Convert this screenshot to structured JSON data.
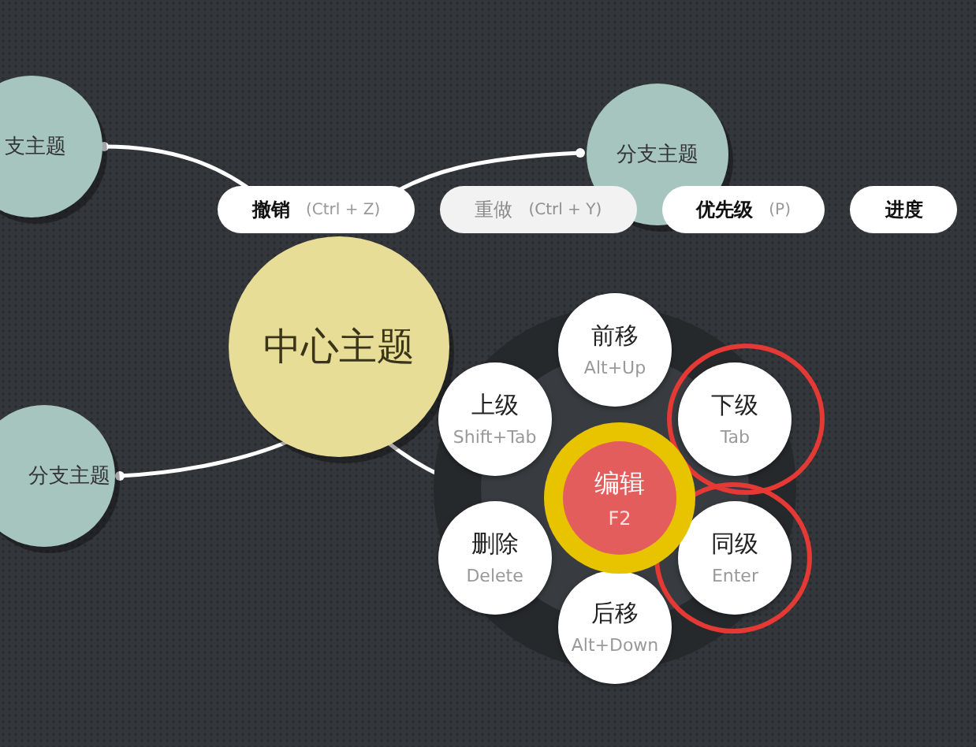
{
  "branch_topics": [
    {
      "text": "支主题"
    },
    {
      "text": "分支主题"
    },
    {
      "text": "分支主题"
    }
  ],
  "central_topic": {
    "text": "中心主题"
  },
  "toolbar": [
    {
      "label": "撤销",
      "shortcut": "(Ctrl + Z)",
      "disabled": false
    },
    {
      "label": "重做",
      "shortcut": "(Ctrl + Y)",
      "disabled": true
    },
    {
      "label": "优先级",
      "shortcut": "(P)",
      "disabled": false
    },
    {
      "label": "进度",
      "disabled": false
    }
  ],
  "radial_menu": {
    "center": {
      "label": "编辑",
      "shortcut": "F2"
    },
    "items": [
      {
        "label": "前移",
        "shortcut": "Alt+Up",
        "highlighted": false
      },
      {
        "label": "上级",
        "shortcut": "Shift+Tab",
        "highlighted": false
      },
      {
        "label": "下级",
        "shortcut": "Tab",
        "highlighted": true
      },
      {
        "label": "删除",
        "shortcut": "Delete",
        "highlighted": false
      },
      {
        "label": "同级",
        "shortcut": "Enter",
        "highlighted": true
      },
      {
        "label": "后移",
        "shortcut": "Alt+Down",
        "highlighted": false
      }
    ]
  }
}
